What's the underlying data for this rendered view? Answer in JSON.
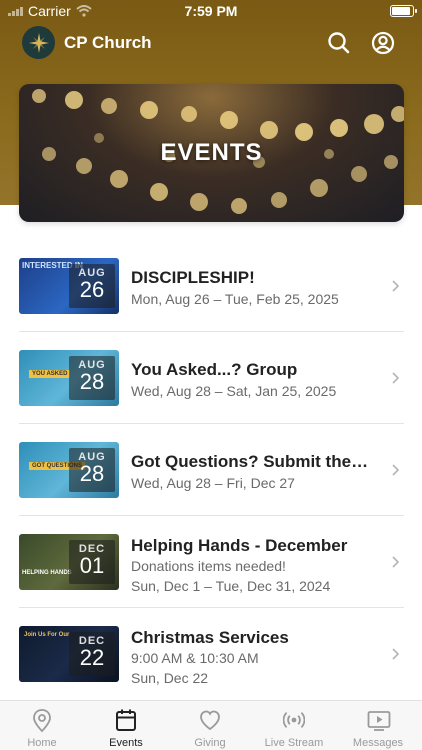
{
  "status_bar": {
    "carrier": "Carrier",
    "time": "7:59 PM"
  },
  "header": {
    "title": "CP Church",
    "logo_icon": "compass-star-icon",
    "search_icon": "search-icon",
    "profile_icon": "profile-icon"
  },
  "banner": {
    "title": "EVENTS"
  },
  "colors": {
    "header_brown": "#7a5a14",
    "active_tab": "#222222",
    "inactive_tab": "#9a9a9a"
  },
  "events": [
    {
      "title": "DISCIPLESHIP!",
      "line1": "Mon, Aug 26 – Tue, Feb 25, 2025",
      "line2": "",
      "badge_month": "AUG",
      "badge_day": "26",
      "thumb_text": "INTERESTED IN"
    },
    {
      "title": "You Asked...? Group",
      "line1": "Wed, Aug 28 – Sat, Jan 25, 2025",
      "line2": "",
      "badge_month": "AUG",
      "badge_day": "28",
      "thumb_text": "YOU ASKED"
    },
    {
      "title": "Got Questions? Submit them for Sunday",
      "line1": "Wed, Aug 28 – Fri, Dec 27",
      "line2": "",
      "badge_month": "AUG",
      "badge_day": "28",
      "thumb_text": "GOT QUESTIONS"
    },
    {
      "title": "Helping Hands - December",
      "line1": "Donations items needed!",
      "line2": "Sun, Dec 1 – Tue, Dec 31, 2024",
      "badge_month": "DEC",
      "badge_day": "01",
      "thumb_text": "HELPING HANDS"
    },
    {
      "title": "Christmas Services",
      "line1": "9:00 AM & 10:30 AM",
      "line2": "Sun, Dec 22",
      "badge_month": "DEC",
      "badge_day": "22",
      "thumb_text": "Join Us For Our"
    }
  ],
  "tabs": [
    {
      "label": "Home",
      "icon": "location-pin-icon",
      "active": false
    },
    {
      "label": "Events",
      "icon": "calendar-icon",
      "active": true
    },
    {
      "label": "Giving",
      "icon": "heart-icon",
      "active": false
    },
    {
      "label": "Live Stream",
      "icon": "broadcast-icon",
      "active": false
    },
    {
      "label": "Messages",
      "icon": "video-play-icon",
      "active": false
    }
  ]
}
